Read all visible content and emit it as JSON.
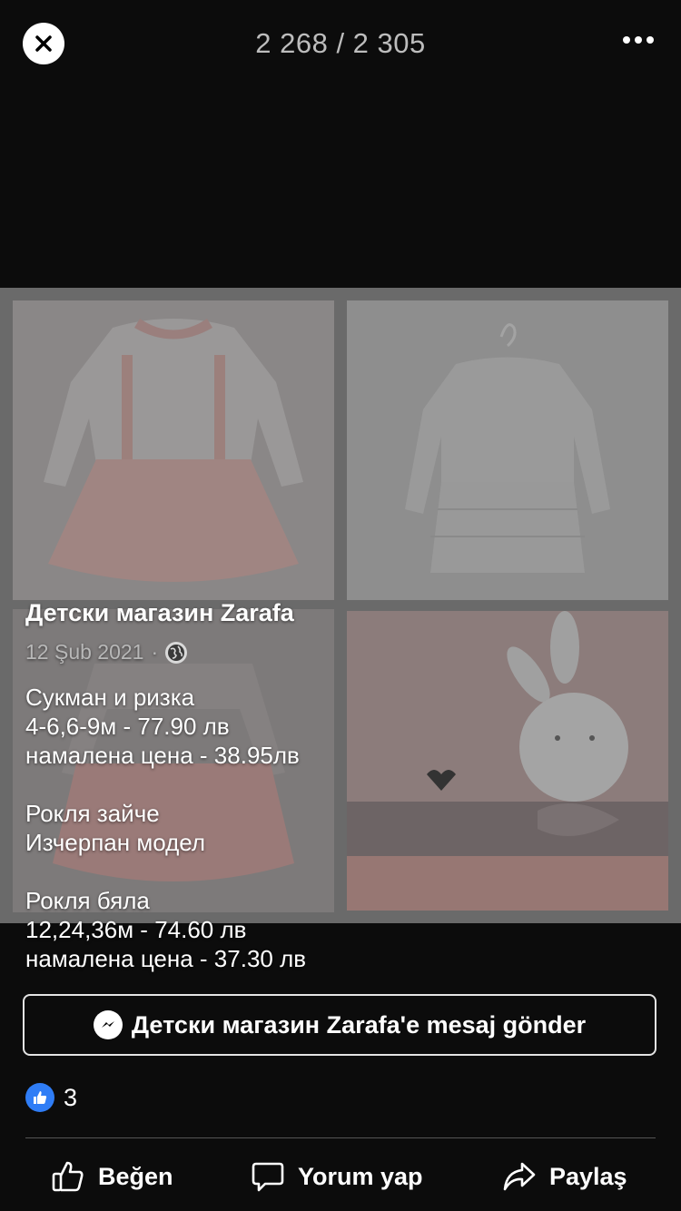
{
  "viewer": {
    "counter": "2 268 / 2 305",
    "close_icon": "close-icon",
    "more_icon": "more-horizontal-icon"
  },
  "post": {
    "page_name": "Детски магазин  Zarafa",
    "date": "12 Şub 2021",
    "separator": "·",
    "audience_icon": "globe-icon",
    "lines": [
      "Сукман и ризка",
      "4-6,6-9м - 77.90 лв",
      "намалена цена - 38.95лв",
      "",
      "Рокля зайче",
      "Изчерпан модел",
      "",
      "Рокля бяла",
      "12,24,36м - 74.60 лв",
      "намалена цена - 37.30 лв"
    ]
  },
  "message_button": {
    "label": "Детски магазин  Zarafa'e mesaj gönder",
    "icon": "messenger-icon"
  },
  "reactions": {
    "icon": "like-icon",
    "count": "3"
  },
  "actions": {
    "like": "Beğen",
    "comment": "Yorum yap",
    "share": "Paylaş"
  },
  "colors": {
    "background": "#0c0c0c",
    "like_blue": "#2f7df6",
    "counter_text": "#bdbdbd"
  }
}
